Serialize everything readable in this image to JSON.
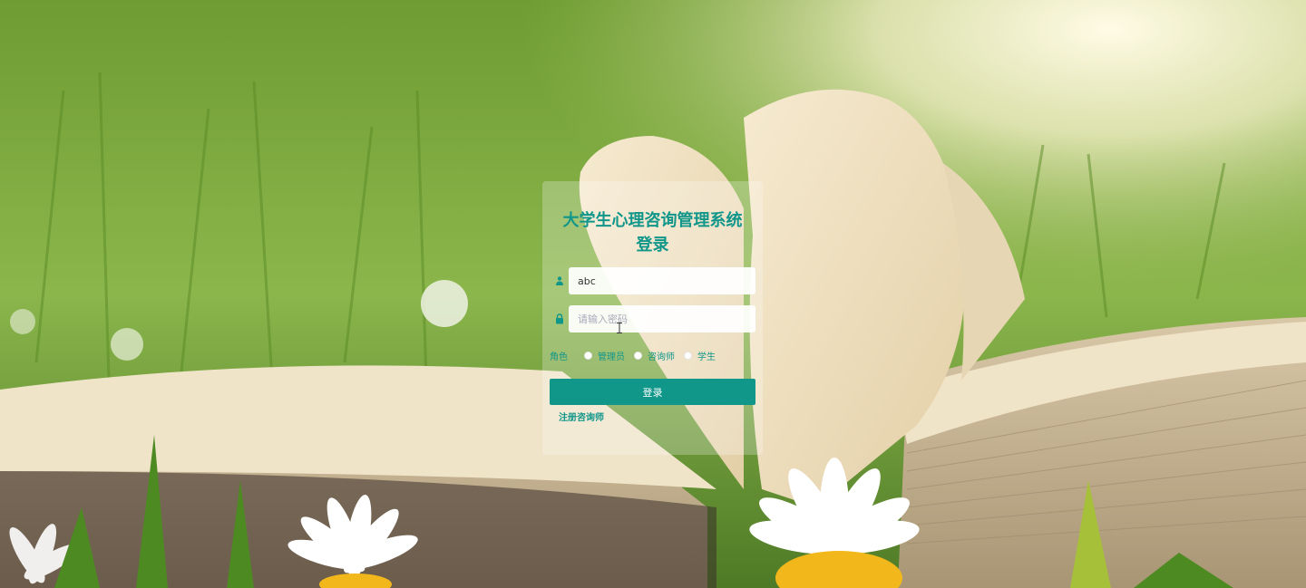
{
  "login": {
    "title_line1": "大学生心理咨询管理系统",
    "title_line2": "登录",
    "username_value": "abc",
    "password_placeholder": "请输入密码",
    "role_label": "角色",
    "roles": [
      "管理员",
      "咨询师",
      "学生"
    ],
    "login_button": "登录",
    "register_link": "注册咨询师"
  },
  "icons": {
    "user": "user-icon",
    "lock": "lock-icon"
  },
  "colors": {
    "accent": "#11968a"
  }
}
